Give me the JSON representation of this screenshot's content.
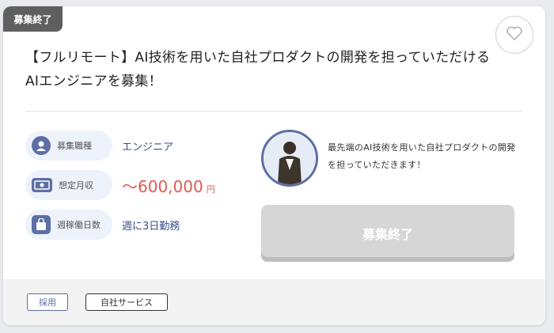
{
  "job": {
    "status": "募集終了",
    "title": "【フルリモート】AI技術を用いた自社プロダクトの開発を担っていただけるAIエンジニアを募集！"
  },
  "info": {
    "role_label": "募集職種",
    "role_value": "エンジニア",
    "salary_label": "想定月収",
    "salary_value": "〜600,000",
    "salary_unit": "円",
    "days_label": "週稼働日数",
    "days_value": "週に3日勤務"
  },
  "message": "最先端のAI技術を用いた自社プロダクトの開発を担っていただきます！",
  "apply_button": "募集終了",
  "tags": [
    "採用",
    "自社サービス"
  ],
  "colors": {
    "accent": "#5d6fa4",
    "salary": "#e05a50",
    "badge": "#5f5f5f",
    "disabled_button": "#d6d6d6"
  },
  "icons": {
    "favorite": "heart-icon",
    "role": "person-icon",
    "salary": "money-icon",
    "days": "bag-icon"
  }
}
